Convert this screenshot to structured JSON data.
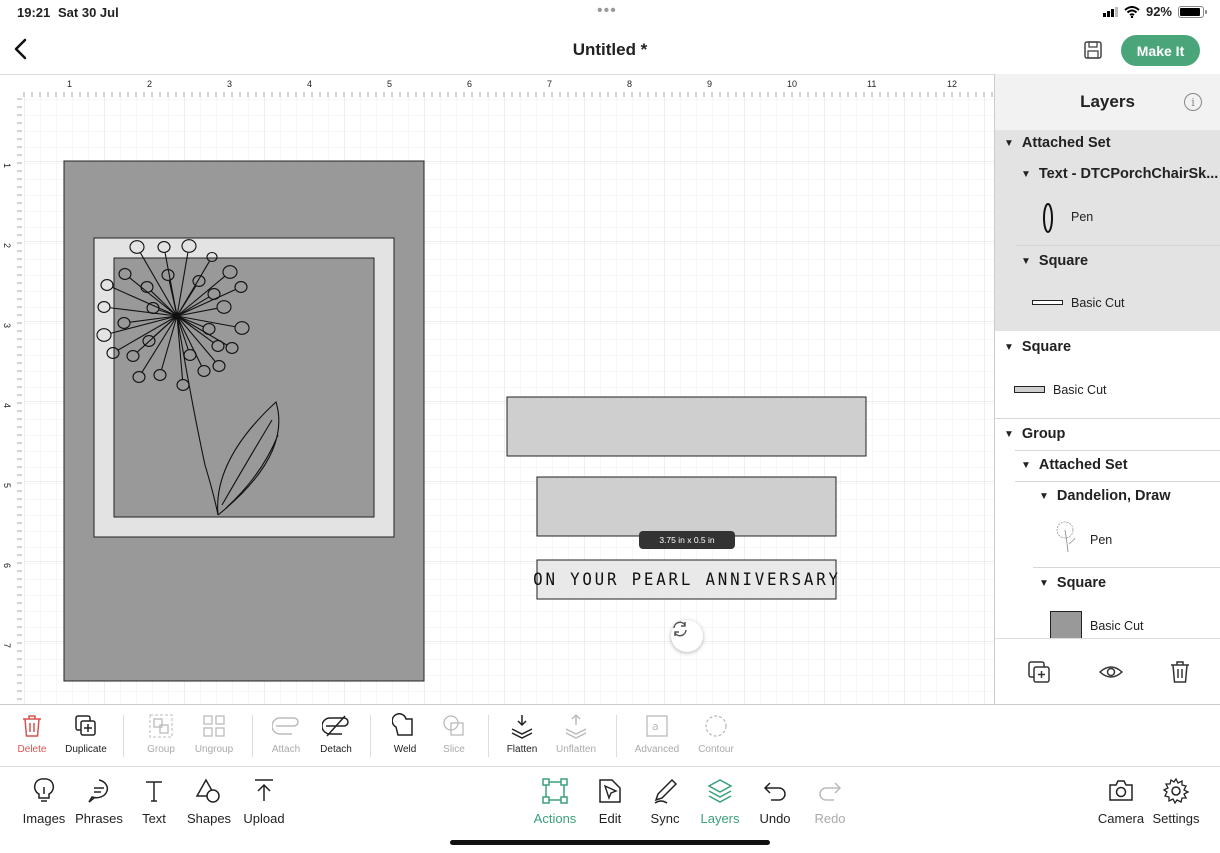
{
  "status_bar": {
    "time": "19:21",
    "date": "Sat 30 Jul",
    "battery": "92%",
    "battery_level": 0.92
  },
  "header": {
    "title": "Untitled *",
    "make_it_label": "Make It"
  },
  "canvas": {
    "ruler_top": [
      "1",
      "2",
      "3",
      "4",
      "5",
      "6",
      "7",
      "8",
      "9",
      "10",
      "11",
      "12"
    ],
    "ruler_left": [
      "1",
      "2",
      "3",
      "4",
      "5",
      "6",
      "7"
    ],
    "size_tooltip": "3.75 in x 0.5 in",
    "pearl_text": "ON YOUR PEARL ANNIVERSARY"
  },
  "layers": {
    "title": "Layers",
    "attached_set_1": "Attached Set",
    "text_layer": "Text - DTCPorchChairSk...",
    "pen_1": "Pen",
    "square_1": "Square",
    "basic_cut_1": "Basic Cut",
    "square_2": "Square",
    "basic_cut_2": "Basic Cut",
    "group": "Group",
    "attached_set_2": "Attached Set",
    "dandelion": "Dandelion, Draw",
    "pen_2": "Pen",
    "square_3": "Square",
    "basic_cut_3": "Basic Cut"
  },
  "edit_tools": {
    "delete": "Delete",
    "duplicate": "Duplicate",
    "group": "Group",
    "ungroup": "Ungroup",
    "attach": "Attach",
    "detach": "Detach",
    "weld": "Weld",
    "slice": "Slice",
    "flatten": "Flatten",
    "unflatten": "Unflatten",
    "advanced": "Advanced",
    "contour": "Contour"
  },
  "nav": {
    "images": "Images",
    "phrases": "Phrases",
    "text": "Text",
    "shapes": "Shapes",
    "upload": "Upload",
    "actions": "Actions",
    "edit": "Edit",
    "sync": "Sync",
    "layers": "Layers",
    "undo": "Undo",
    "redo": "Redo",
    "camera": "Camera",
    "settings": "Settings"
  },
  "colors": {
    "accent": "#4aa67a",
    "card_grey": "#999999",
    "panel_grey": "#cccccc",
    "delete_red": "#d9534f"
  }
}
